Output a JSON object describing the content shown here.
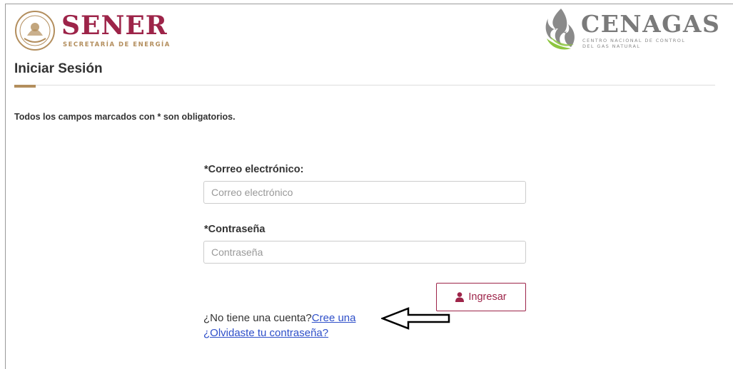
{
  "header": {
    "sener": {
      "seal_text": "ESTADOS UNIDOS MEXICANOS",
      "name": "SENER",
      "subtitle": "SECRETARÍA DE ENERGÍA"
    },
    "cenagas": {
      "name": "CENAGAS",
      "subtitle_line1": "CENTRO NACIONAL DE CONTROL",
      "subtitle_line2": "DEL GAS NATURAL"
    }
  },
  "page": {
    "title": "Iniciar Sesión",
    "required_note": "Todos los campos marcados con * son obligatorios."
  },
  "form": {
    "email": {
      "label": "*Correo electrónico:",
      "placeholder": "Correo electrónico",
      "value": ""
    },
    "password": {
      "label": "*Contraseña",
      "placeholder": "Contraseña",
      "value": ""
    },
    "submit_label": "Ingresar",
    "submit_icon": "user-icon"
  },
  "links": {
    "no_account_text": "¿No tiene una cuenta?",
    "create_account": "Cree una",
    "forgot_password": "¿Olvidaste tu contraseña?"
  },
  "colors": {
    "brand": "#9d2449",
    "gold": "#b38e5d",
    "link": "#2e4fc9"
  },
  "annotation": {
    "icon": "arrow-left-icon"
  }
}
